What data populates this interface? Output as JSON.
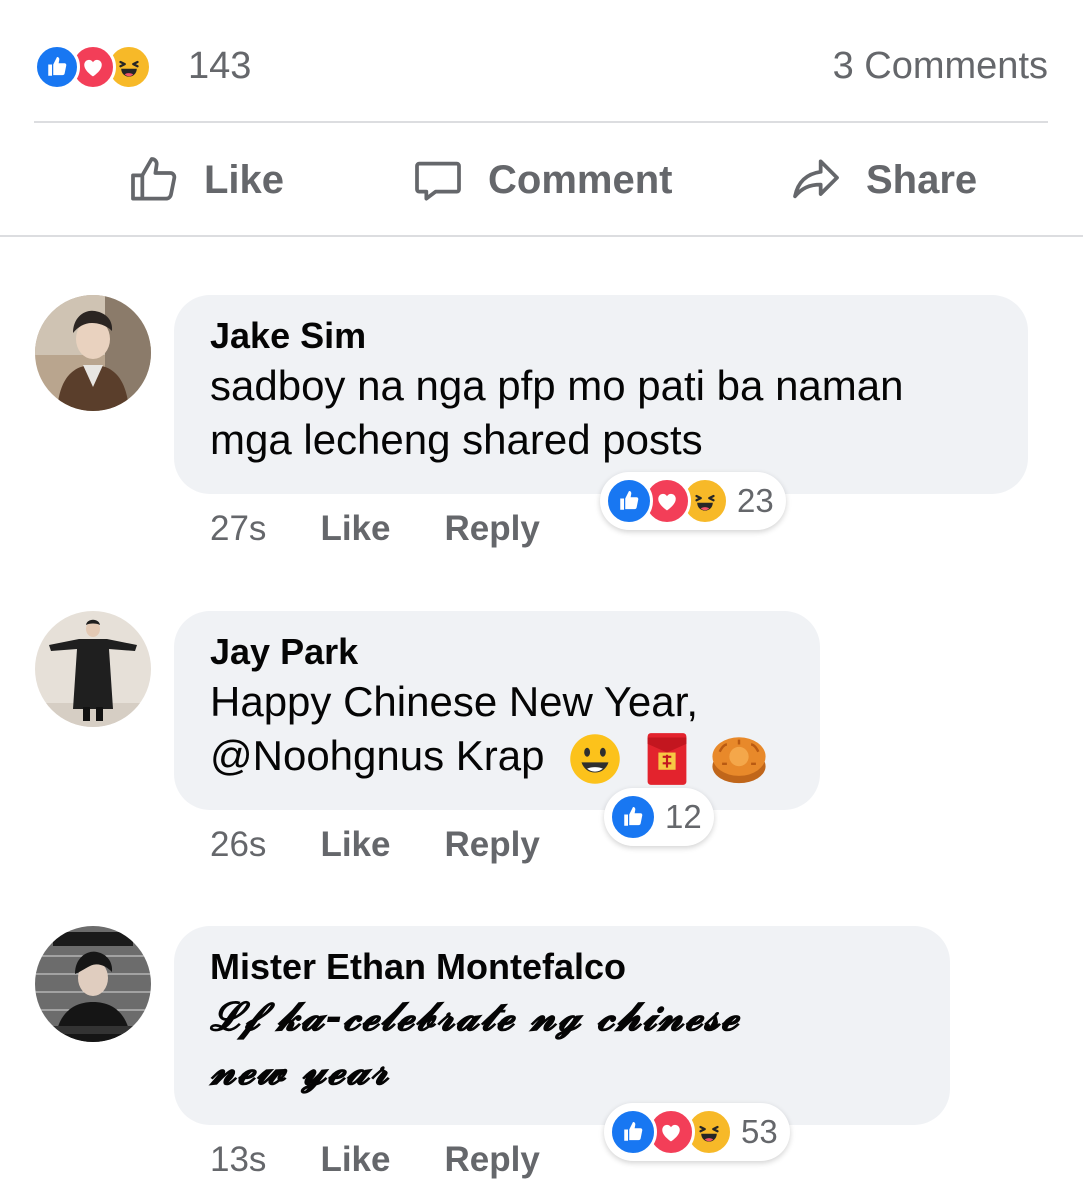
{
  "post": {
    "reaction_count": "143",
    "comments_label": "3 Comments",
    "reactions": [
      "like-icon",
      "love-icon",
      "haha-icon"
    ]
  },
  "actions": {
    "like": "Like",
    "comment": "Comment",
    "share": "Share"
  },
  "colors": {
    "like_blue": "#1877f2",
    "love_red": "#f33e58",
    "haha_yellow": "#f7b928",
    "bubble_bg": "#f0f2f5",
    "meta_gray": "#65676b"
  },
  "comments": [
    {
      "author": "Jake Sim",
      "text_line1": "sadboy na nga pfp mo pati ba naman",
      "text_line2": "mga lecheng shared posts",
      "time": "27s",
      "like": "Like",
      "reply": "Reply",
      "reaction_count": "23",
      "reactions": [
        "like-icon",
        "love-icon",
        "haha-icon"
      ]
    },
    {
      "author": "Jay Park",
      "text_line1": "Happy Chinese New Year,",
      "text_line2": "@Noohgnus Krap",
      "emojis": [
        "smiley-emoji",
        "red-envelope-emoji",
        "mooncake-emoji"
      ],
      "time": "26s",
      "like": "Like",
      "reply": "Reply",
      "reaction_count": "12",
      "reactions": [
        "like-icon"
      ]
    },
    {
      "author": "Mister Ethan Montefalco",
      "text_line1": "𝓛𝓯 𝓴𝓪-𝓬𝓮𝓵𝓮𝓫𝓻𝓪𝓽𝓮 𝓷𝓰 𝓬𝓱𝓲𝓷𝓮𝓼𝓮",
      "text_line2": "𝓷𝓮𝔀 𝔂𝓮𝓪𝓻",
      "time": "13s",
      "like": "Like",
      "reply": "Reply",
      "reaction_count": "53",
      "reactions": [
        "like-icon",
        "love-icon",
        "haha-icon"
      ]
    }
  ]
}
